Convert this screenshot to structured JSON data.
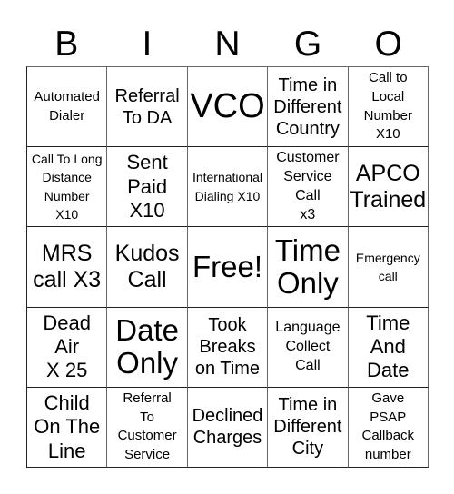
{
  "header": {
    "letters": [
      "B",
      "I",
      "N",
      "G",
      "O"
    ]
  },
  "grid": {
    "rows": [
      [
        "Automated\nDialer",
        "Referral\nTo DA",
        "VCO",
        "Time in\nDifferent\nCountry",
        "Call to\nLocal\nNumber\nX10"
      ],
      [
        "Call To Long\nDistance\nNumber\nX10",
        "Sent\nPaid\nX10",
        "International\nDialing X10",
        "Customer\nService\nCall\nx3",
        "APCO\nTrained"
      ],
      [
        "MRS\ncall X3",
        "Kudos\nCall",
        "Free!",
        "Time\nOnly",
        "Emergency\ncall"
      ],
      [
        "Dead\nAir\nX 25",
        "Date\nOnly",
        "Took\nBreaks\non Time",
        "Language\nCollect\nCall",
        "Time\nAnd\nDate"
      ],
      [
        "Child\nOn The\nLine",
        "Referral\nTo\nCustomer\nService",
        "Declined\nCharges",
        "Time in\nDifferent\nCity",
        "Gave\nPSAP\nCallback\nnumber"
      ]
    ]
  }
}
